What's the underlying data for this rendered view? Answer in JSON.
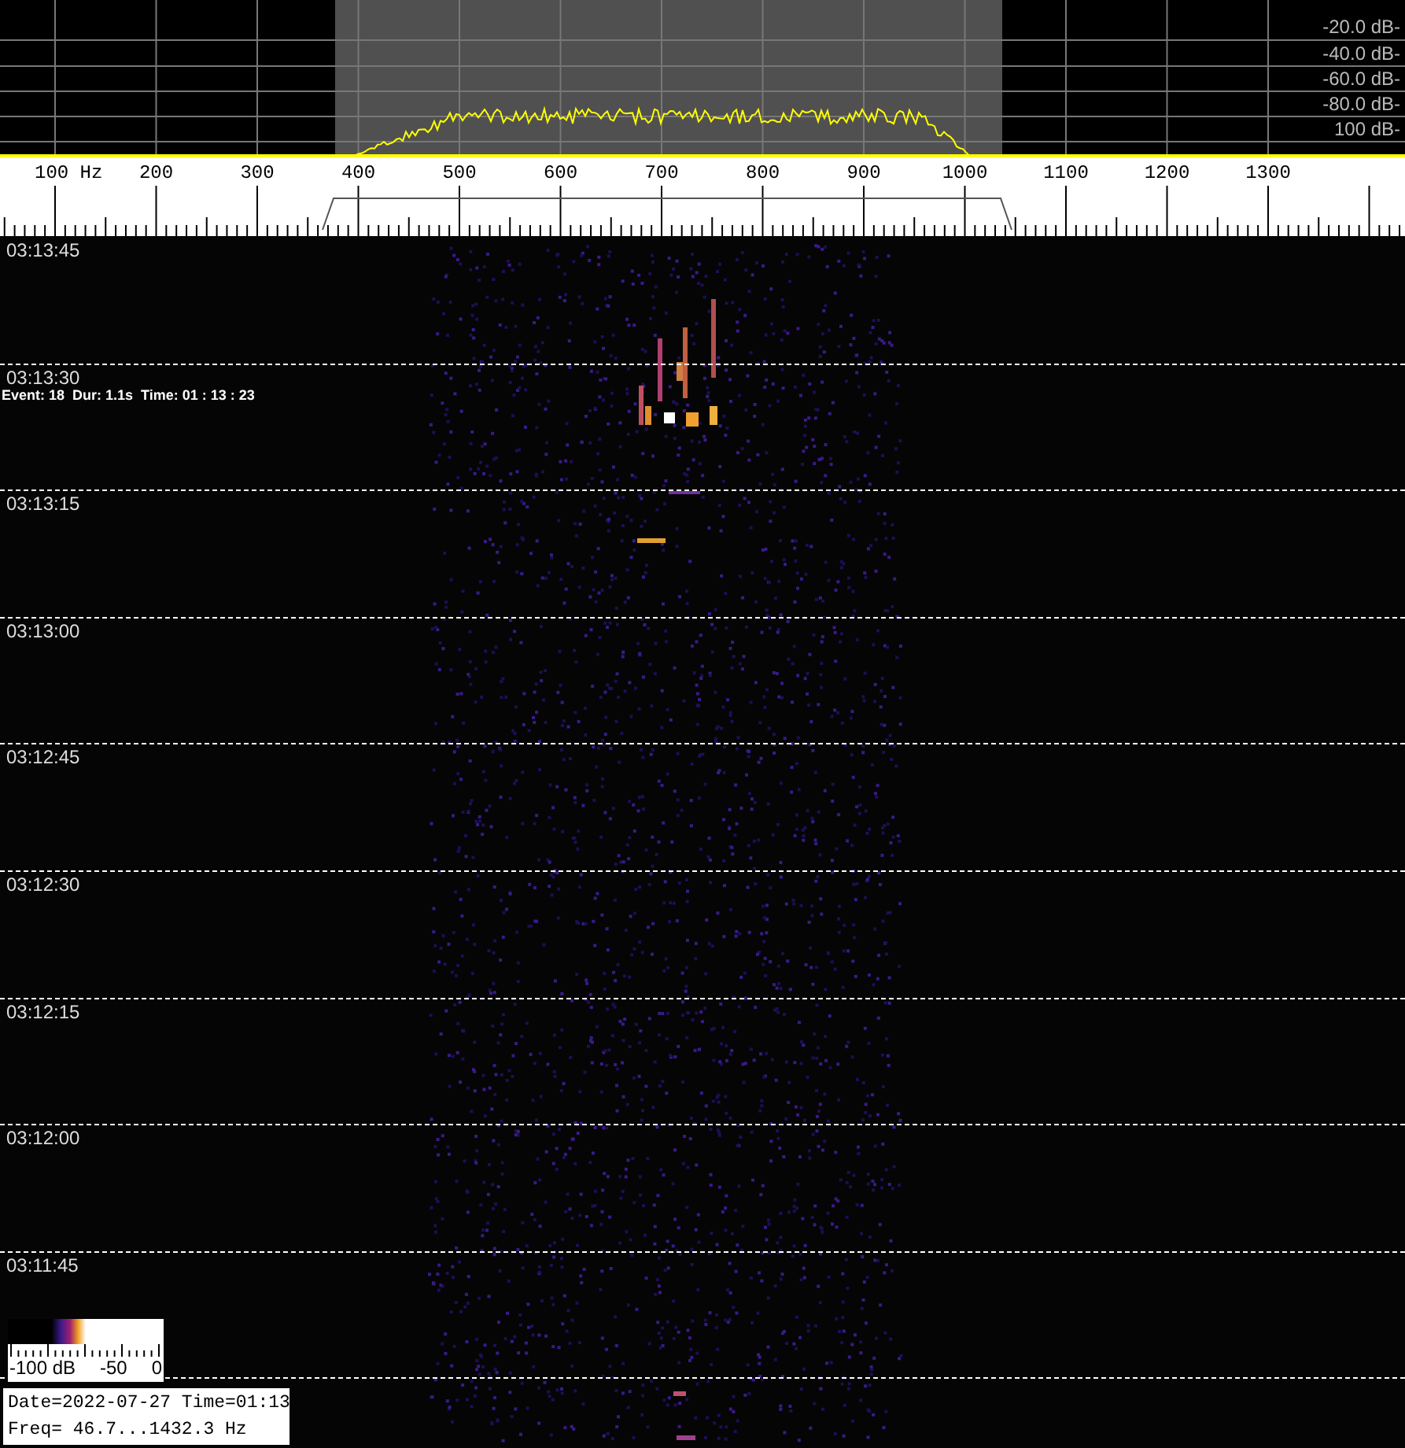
{
  "spectrum": {
    "db_labels": [
      "-20.0 dB-",
      "-40.0 dB-",
      "-60.0 dB-",
      "-80.0 dB-",
      "100 dB-"
    ]
  },
  "frequency_scale": {
    "labels": [
      "100 Hz",
      "200",
      "300",
      "400",
      "500",
      "600",
      "700",
      "800",
      "900",
      "1000",
      "1100",
      "1200",
      "1300"
    ]
  },
  "waterfall": {
    "time_labels": [
      "03:13:45",
      "03:13:30",
      "03:13:15",
      "03:13:00",
      "03:12:45",
      "03:12:30",
      "03:12:15",
      "03:12:00",
      "03:11:45"
    ],
    "event_label": "Event: 18  Dur: 1.1s  Time: 01 : 13 : 23"
  },
  "colorbar": {
    "labels": [
      "-100 dB",
      "-50",
      "0"
    ]
  },
  "info": {
    "lines": [
      "Date=2022-07-27 Time=01:13",
      "Freq= 46.7...1432.3 Hz"
    ]
  }
}
